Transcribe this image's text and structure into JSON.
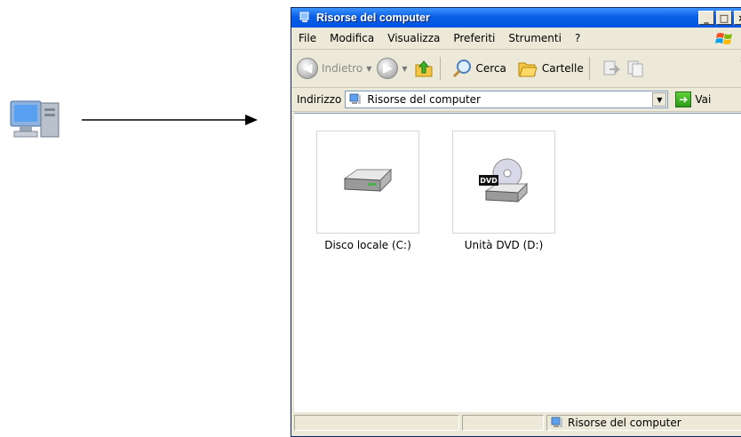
{
  "window": {
    "title": "Risorse del computer",
    "controls": {
      "minimize": "_",
      "maximize": "□",
      "close": "×"
    }
  },
  "menu": [
    "File",
    "Modifica",
    "Visualizza",
    "Preferiti",
    "Strumenti",
    "?"
  ],
  "toolbar": {
    "back_label": "Indietro",
    "search_label": "Cerca",
    "folders_label": "Cartelle",
    "more": "»"
  },
  "address": {
    "label": "Indirizzo",
    "value": "Risorse del computer",
    "go_label": "Vai"
  },
  "items": [
    {
      "name": "Disco locale (C:)",
      "icon": "hard-disk-icon"
    },
    {
      "name": "Unità DVD (D:)",
      "icon": "dvd-drive-icon",
      "badge": "DVD"
    }
  ],
  "status": {
    "text": "Risorse del computer"
  },
  "colors": {
    "titlebar": "#0054e3",
    "window_bg": "#ece9d8",
    "go_green": "#2b9a18"
  }
}
